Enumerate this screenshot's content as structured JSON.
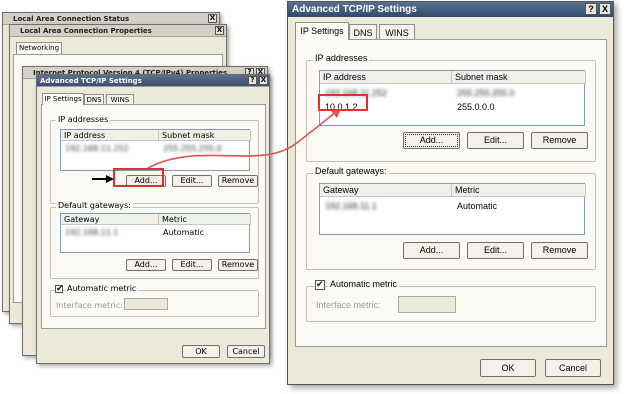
{
  "windows": {
    "lac_status_title": "Local Area Connection Status",
    "lac_props_title": "Local Area Connection Properties",
    "lac_props_tab": "Networking",
    "ipv4_title": "Internet Protocol Version 4 (TCP/IPv4) Properties",
    "ipv4_help": "?",
    "close": "X"
  },
  "small_dialog": {
    "title": "Advanced TCP/IP Settings",
    "help": "?",
    "close": "X",
    "tabs": [
      "IP Settings",
      "DNS",
      "WINS"
    ],
    "ip_group_label": "IP addresses",
    "ip_columns": [
      "IP address",
      "Subnet mask"
    ],
    "ip_row": [
      "192.168.11.252",
      "255.255.255.0"
    ],
    "gw_group_label": "Default gateways:",
    "gw_columns": [
      "Gateway",
      "Metric"
    ],
    "gw_row": [
      "192.168.11.1",
      "Automatic"
    ],
    "add": "Add...",
    "edit": "Edit...",
    "remove": "Remove",
    "auto_metric": "Automatic metric",
    "interface_metric": "Interface metric:",
    "ok": "OK",
    "cancel": "Cancel"
  },
  "big_dialog": {
    "title": "Advanced TCP/IP Settings",
    "help": "?",
    "close": "X",
    "tabs": [
      "IP Settings",
      "DNS",
      "WINS"
    ],
    "ip_group_label": "IP addresses",
    "ip_columns": [
      "IP address",
      "Subnet mask"
    ],
    "ip_rows": [
      [
        "192.168.11.252",
        "255.255.255.0"
      ],
      [
        "10.0.1.2",
        "255.0.0.0"
      ]
    ],
    "gw_group_label": "Default gateways:",
    "gw_columns": [
      "Gateway",
      "Metric"
    ],
    "gw_row": [
      "192.168.11.1",
      "Automatic"
    ],
    "add": "Add...",
    "edit": "Edit...",
    "remove": "Remove",
    "auto_metric": "Automatic metric",
    "interface_metric": "Interface metric:",
    "ok": "OK",
    "cancel": "Cancel"
  },
  "annotation": {
    "highlight_color": "#e03030",
    "arrow_color": "#e05555"
  }
}
